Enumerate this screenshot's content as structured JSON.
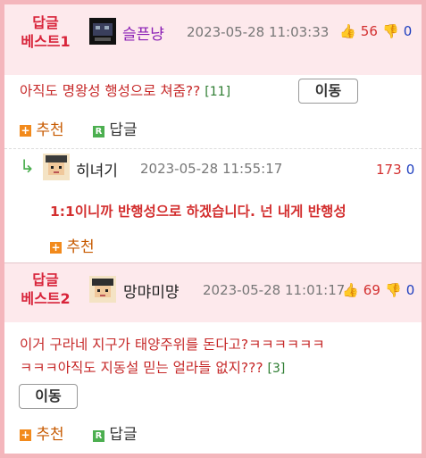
{
  "comments": [
    {
      "badge_line1": "답글",
      "badge_line2": "베스트1",
      "nickname": "슬픈냥",
      "datetime": "2023-05-28 11:03:33",
      "upvotes": "56",
      "downvotes": "0",
      "text": "아직도 명왕성 행성으로 쳐줌??",
      "reply_count": "[11]",
      "move_label": "이동",
      "recommend_label": "추천",
      "reply_label": "답글"
    },
    {
      "nickname": "히녀기",
      "datetime": "2023-05-28 11:55:17",
      "upvotes": "173",
      "downvotes": "0",
      "text": "1:1이니까 반행성으로 하겠습니다. 넌 내게 반행성",
      "recommend_label": "추천"
    },
    {
      "badge_line1": "답글",
      "badge_line2": "베스트2",
      "nickname": "망먀미먕",
      "datetime": "2023-05-28 11:01:17",
      "upvotes": "69",
      "downvotes": "0",
      "text_line1": "이거 구라네 지구가 태양주위를 돈다고?ㅋㅋㅋㅋㅋㅋ",
      "text_line2": "ㅋㅋㅋ아직도 지동설 믿는 얼라들 없지???",
      "reply_count": "[3]",
      "move_label": "이동",
      "recommend_label": "추천",
      "reply_label": "답글"
    }
  ],
  "icons": {
    "thumbs_up": "👍",
    "thumbs_down": "👎",
    "reply_arrow": "↳",
    "plus": "+",
    "r_mark": "R"
  },
  "colors": {
    "badge": "#d8243a",
    "header_bg": "#fde9ec",
    "border": "#f4b6bc"
  }
}
